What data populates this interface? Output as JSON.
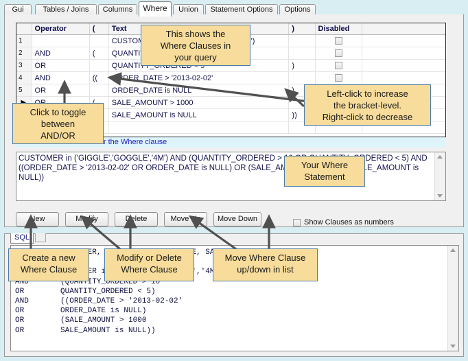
{
  "tabs": [
    {
      "label": "Gui",
      "active": false
    },
    {
      "label": "Tables / Joins",
      "active": false
    },
    {
      "label": "Columns",
      "active": false
    },
    {
      "label": "Where",
      "active": true
    },
    {
      "label": "Union",
      "active": false
    },
    {
      "label": "Statement Options",
      "active": false
    },
    {
      "label": "Options",
      "active": false
    }
  ],
  "grid": {
    "headers": [
      "",
      "Operator",
      "(",
      "Text",
      ")",
      "Disabled",
      ""
    ],
    "rows": [
      {
        "num": "1",
        "operator": "",
        "open": "",
        "text": "CUSTOMER in ('GIGGLE','GOGGLE','4M')",
        "close": "",
        "disabled": false
      },
      {
        "num": "2",
        "operator": "AND",
        "open": "(",
        "text": "QUANTITY_ORDERED > 10",
        "close": "",
        "disabled": false
      },
      {
        "num": "3",
        "operator": "OR",
        "open": "",
        "text": "QUANTITY_ORDERED < 5",
        "close": ")",
        "disabled": false
      },
      {
        "num": "4",
        "operator": "AND",
        "open": "((",
        "text": "ORDER_DATE > '2013-02-02'",
        "close": "",
        "disabled": false
      },
      {
        "num": "5",
        "operator": "OR",
        "open": "",
        "text": "ORDER_DATE is NULL",
        "close": ")",
        "disabled": false
      },
      {
        "num": "▶",
        "operator": "OR",
        "open": "(",
        "text": "SALE_AMOUNT > 1000",
        "close": "",
        "disabled": false
      },
      {
        "num": "",
        "operator": "",
        "open": "",
        "text": "SALE_AMOUNT is NULL",
        "close": "))",
        "disabled": false
      },
      {
        "num": "",
        "operator": "",
        "open": "",
        "text": "",
        "close": "",
        "disabled": null
      }
    ]
  },
  "hint": "Double-click a row to alter the Where clause",
  "where_statement": "CUSTOMER in ('GIGGLE','GOGGLE','4M') AND (QUANTITY_ORDERED > 10 OR QUANTITY_ORDERED < 5) AND ((ORDER_DATE > '2013-02-02' OR ORDER_DATE is NULL) OR (SALE_AMOUNT > 1000 OR SALE_AMOUNT is NULL))",
  "buttons": [
    {
      "label": "New"
    },
    {
      "label": "Modify"
    },
    {
      "label": "Delete"
    },
    {
      "label": "Move Up"
    },
    {
      "label": "Move Down"
    }
  ],
  "show_clauses_checkbox": {
    "label": "Show Clauses as numbers",
    "checked": false
  },
  "sql_panel": {
    "tab_label": "SQL",
    "sql": "SELECT    CUSTOMER, ORDER_NO, ORDER_DATE, SALE_AMOUNT, MONTH\nFROM      ORDERS\nWHERE     CUSTOMER in ('GIGGLE','GOGGLE','4M')\nAND       (QUANTITY_ORDERED > 10\nOR        QUANTITY_ORDERED < 5)\nAND       ((ORDER_DATE > '2013-02-02'\nOR        ORDER_DATE is NULL)\nOR        (SALE_AMOUNT > 1000\nOR        SALE_AMOUNT is NULL))"
  },
  "callouts": {
    "grid_info": "This shows the\nWhere Clauses in\nyour query",
    "toggle": "Click to toggle\nbetween\nAND/OR",
    "bracket": "Left-click to increase\nthe bracket-level.\nRight-click to decrease",
    "where_statement": "Your Where\nStatement",
    "new_clause": "Create  a new\nWhere Clause",
    "modify_delete": "Modify or Delete\nWhere Clause",
    "move_clause": "Move Where Clause\nup/down in list"
  },
  "colors": {
    "callout_bg": "#f7dc9b",
    "callout_border": "#4a7ba8",
    "hint_bg": "#ddf4fb",
    "hint_text": "#1f1fbf",
    "window_bg": "#d8eef2",
    "panel_bg": "#f0f0f0",
    "arrow": "#505050"
  }
}
